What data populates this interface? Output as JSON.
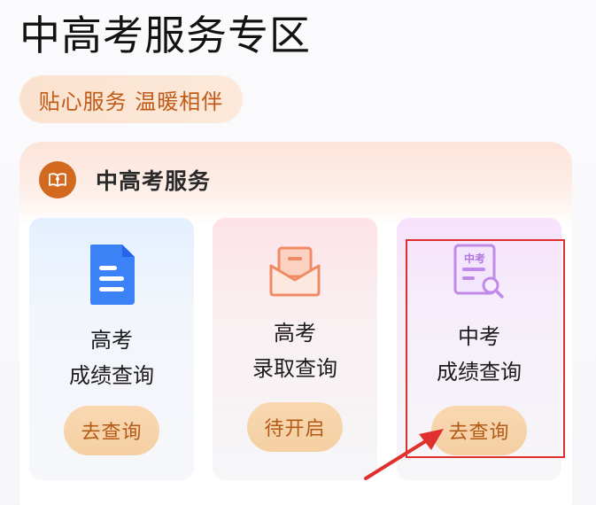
{
  "page": {
    "title": "中高考服务专区",
    "subtitle": "贴心服务 温暖相伴"
  },
  "section": {
    "title": "中高考服务",
    "icon": "book-icon"
  },
  "tiles": [
    {
      "line1": "高考",
      "line2": "成绩查询",
      "button": "去查询",
      "icon": "document-icon",
      "icon_color": "#3b82f6"
    },
    {
      "line1": "高考",
      "line2": "录取查询",
      "button": "待开启",
      "icon": "envelope-icon",
      "icon_color": "#f08a65"
    },
    {
      "line1": "中考",
      "line2": "成绩查询",
      "button": "去查询",
      "icon": "search-report-icon",
      "icon_color": "#c08ae8",
      "icon_text": "中考"
    }
  ],
  "colors": {
    "accent": "#c15a17",
    "button_bg": "#f6d3a8",
    "highlight": "#e0302e"
  }
}
